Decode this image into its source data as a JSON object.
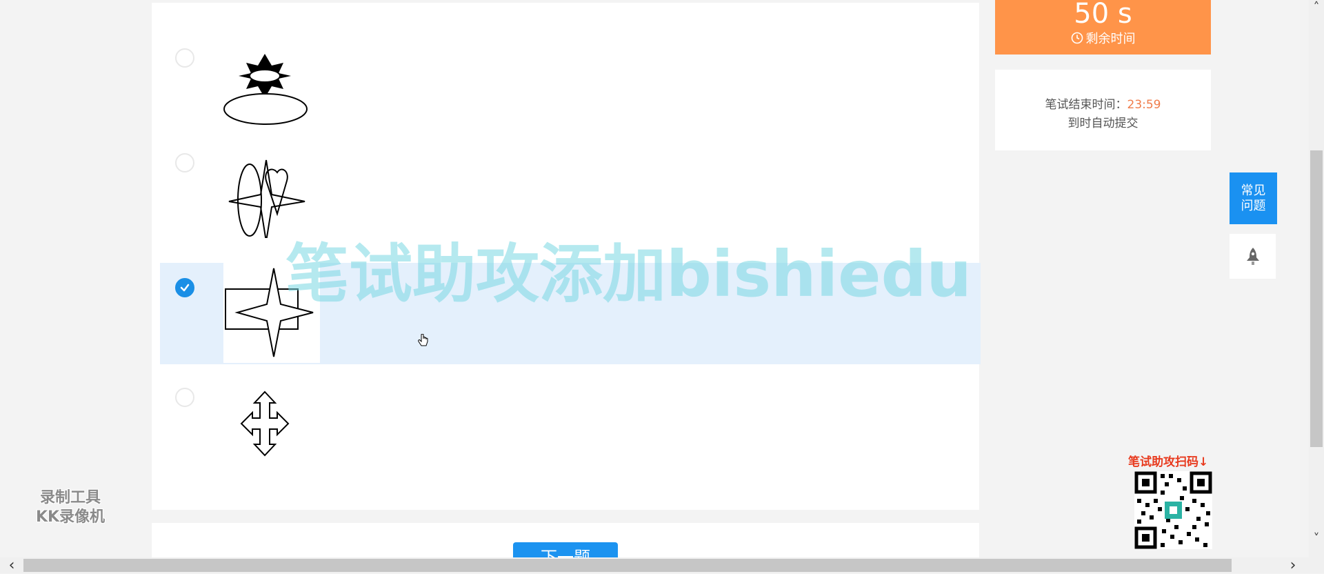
{
  "question": {
    "options": [
      {
        "id": "A",
        "figure": "star-ellipse-figure",
        "selected": false
      },
      {
        "id": "B",
        "figure": "ellipse-star-heart-figure",
        "selected": false
      },
      {
        "id": "C",
        "figure": "rectangle-star-figure",
        "selected": true
      },
      {
        "id": "D",
        "figure": "cross-arrows-figure",
        "selected": false
      }
    ],
    "next_label": "下一题"
  },
  "timer": {
    "remaining": "50 s",
    "remaining_label": "剩余时间"
  },
  "end_info": {
    "label": "笔试结束时间：",
    "time": "23:59",
    "auto_submit": "到时自动提交"
  },
  "sidebar": {
    "faq_label": "常见\n问题"
  },
  "watermark": {
    "text": "笔试助攻添加bishiedu",
    "qr_caption": "笔试助攻扫码↓",
    "recorder_line1": "录制工具",
    "recorder_line2": "KK录像机"
  },
  "colors": {
    "accent_blue": "#1a8fe6",
    "timer_orange": "#ff9449",
    "end_time_orange": "#f07c4a",
    "selected_bg": "#e4f0fc"
  },
  "icons": {
    "clock": "clock-icon",
    "check": "check-icon",
    "rocket": "rocket-icon",
    "scroll_up": "chevron-up-icon",
    "scroll_down": "chevron-down-icon",
    "scroll_left": "chevron-left-icon",
    "scroll_right": "chevron-right-icon",
    "cursor": "hand-cursor-icon"
  }
}
